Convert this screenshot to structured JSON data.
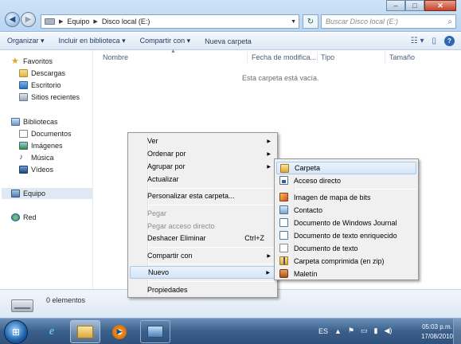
{
  "window": {
    "address": {
      "crumbs": [
        "Equipo",
        "Disco local (E:)"
      ]
    },
    "search_placeholder": "Buscar Disco local (E:)"
  },
  "toolbar": {
    "organize": "Organizar ▾",
    "include": "Incluir en biblioteca ▾",
    "share": "Compartir con ▾",
    "new_folder": "Nueva carpeta"
  },
  "sidebar": {
    "favorites": "Favoritos",
    "fav_items": [
      "Descargas",
      "Escritorio",
      "Sitios recientes"
    ],
    "libraries": "Bibliotecas",
    "lib_items": [
      "Documentos",
      "Imágenes",
      "Música",
      "Vídeos"
    ],
    "computer": "Equipo",
    "network": "Red"
  },
  "columns": [
    "Nombre",
    "Fecha de modifica...",
    "Tipo",
    "Tamaño"
  ],
  "empty_message": "Esta carpeta está vacía.",
  "status": {
    "items": "0 elementos"
  },
  "context_menu": {
    "view": "Ver",
    "sort_by": "Ordenar por",
    "group_by": "Agrupar por",
    "refresh": "Actualizar",
    "customize": "Personalizar esta carpeta...",
    "paste": "Pegar",
    "paste_shortcut": "Pegar acceso directo",
    "undo_delete": "Deshacer Eliminar",
    "undo_shortcut": "Ctrl+Z",
    "share_with": "Compartir con",
    "new": "Nuevo",
    "properties": "Propiedades"
  },
  "new_submenu": {
    "items": [
      "Carpeta",
      "Acceso directo",
      "Imagen de mapa de bits",
      "Contacto",
      "Documento de Windows Journal",
      "Documento de texto enriquecido",
      "Documento de texto",
      "Carpeta comprimida (en zip)",
      "Maletín"
    ]
  },
  "taskbar": {
    "language": "ES",
    "time": "05:03 p.m.",
    "date": "17/08/2010"
  }
}
